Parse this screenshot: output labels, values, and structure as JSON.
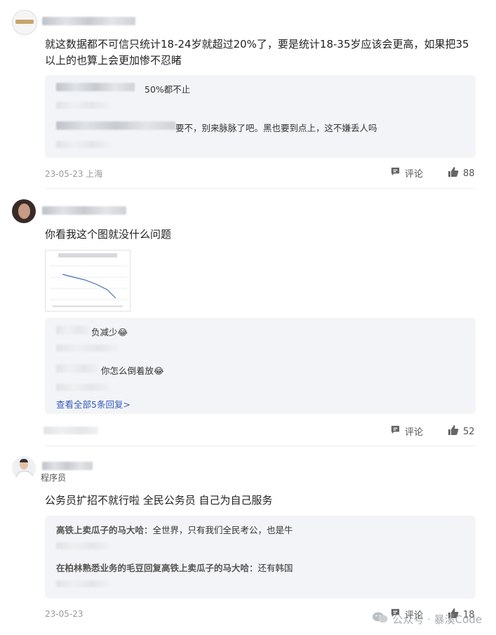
{
  "comments": [
    {
      "text": "就这数据都不可信只统计18-24岁就超过20%了，要是统计18-35岁应该会更高，如果把35以上的也算上会更加惨不忍睹",
      "replies": [
        {
          "content": "50%都不止"
        },
        {
          "content": "要不，别来脉脉了吧。黑也要到点上，这不嫌丢人吗"
        }
      ],
      "meta": "23-05-23 上海",
      "comment_label": "评论",
      "likes": "88"
    },
    {
      "text": "你看我这个图就没什么问题",
      "replies": [
        {
          "content": "负减少😂"
        },
        {
          "content": "你怎么倒着放😂"
        }
      ],
      "view_more": "查看全部5条回复>",
      "comment_label": "评论",
      "likes": "52"
    },
    {
      "badge": "程序员",
      "text": "公务员扩招不就行啦 全民公务员 自己为自己服务",
      "replies": [
        {
          "name": "高铁上卖瓜子的马大哈",
          "content": "：全世界，只有我们全民考公，也是牛"
        },
        {
          "name": "在柏林熟悉业务的毛豆回复高铁上卖瓜子的马大哈",
          "content": "：还有韩国"
        }
      ],
      "meta": "23-05-23",
      "comment_label": "评论",
      "likes": "18"
    }
  ],
  "watermark": "公众号 · 暴溪Code",
  "icons": {
    "comment": "comment-icon",
    "like": "thumbs-up-icon"
  }
}
